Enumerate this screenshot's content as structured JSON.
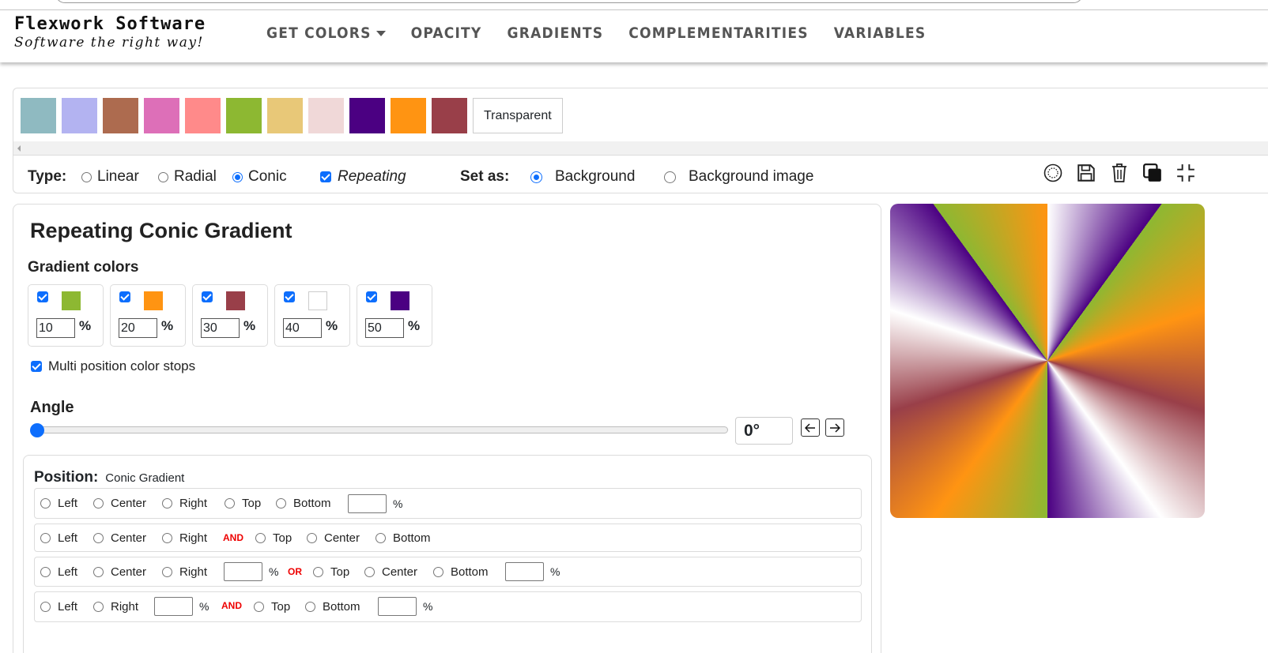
{
  "brand": {
    "name": "Flexwork Software",
    "tagline": "Software the right way!"
  },
  "nav": {
    "items": [
      "GET COLORS",
      "OPACITY",
      "GRADIENTS",
      "COMPLEMENTARITIES",
      "VARIABLES"
    ]
  },
  "swatches": {
    "colors": [
      "#8fbac1",
      "#b3b3f1",
      "#ad6b4f",
      "#dd6fb8",
      "#ff8a8a",
      "#8db832",
      "#e8c878",
      "#f0d8d8",
      "#4b0082",
      "#ff9412",
      "#993f49"
    ],
    "transparent_label": "Transparent"
  },
  "type_row": {
    "type_label": "Type:",
    "linear": "Linear",
    "radial": "Radial",
    "conic": "Conic",
    "repeating": "Repeating",
    "setas_label": "Set as:",
    "background": "Background",
    "background_image": "Background image"
  },
  "tools": [
    "circle-dots-icon",
    "save-icon",
    "trash-icon",
    "copy-icon",
    "compress-icon"
  ],
  "card": {
    "title": "Repeating Conic Gradient",
    "gradient_colors_label": "Gradient colors",
    "stops": [
      {
        "color": "#8db832",
        "value": "10",
        "pct": "%"
      },
      {
        "color": "#ff9412",
        "value": "20",
        "pct": "%"
      },
      {
        "color": "#993f49",
        "value": "30",
        "pct": "%"
      },
      {
        "color": "#ffffff",
        "value": "40",
        "pct": "%"
      },
      {
        "color": "#4b0082",
        "value": "50",
        "pct": "%"
      }
    ],
    "multi_label": "Multi position color stops",
    "angle_label": "Angle",
    "angle_value": "0°",
    "angle_fraction": 0
  },
  "position": {
    "title": "Position:",
    "subtitle": "Conic Gradient",
    "left": "Left",
    "center": "Center",
    "right": "Right",
    "top": "Top",
    "bottom": "Bottom",
    "and": "AND",
    "or": "OR",
    "pct": "%"
  },
  "accent": "#0d6efd"
}
